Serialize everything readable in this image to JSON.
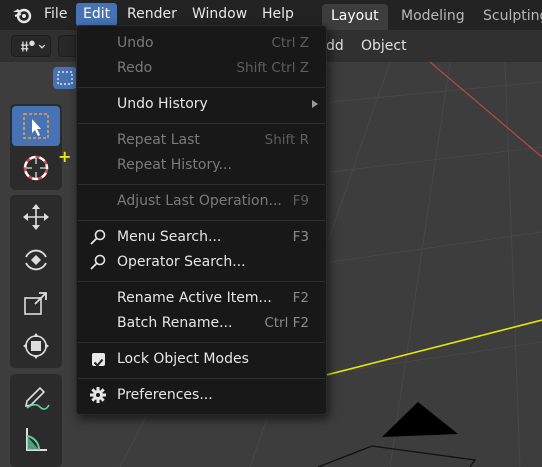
{
  "topbar": {
    "menus": [
      "File",
      "Edit",
      "Render",
      "Window",
      "Help"
    ],
    "active_menu": "Edit",
    "workspaces": [
      "Layout",
      "Modeling",
      "Sculpting"
    ],
    "active_workspace": "Layout"
  },
  "header": {
    "add_label": "dd",
    "object_label": "Object"
  },
  "edit_menu": {
    "items": [
      {
        "label": "Undo",
        "shortcut": "Ctrl Z",
        "enabled": false
      },
      {
        "label": "Redo",
        "shortcut": "Shift Ctrl Z",
        "enabled": false
      },
      {
        "label": "Undo History",
        "shortcut": "",
        "enabled": true,
        "submenu": true
      },
      {
        "label": "Repeat Last",
        "shortcut": "Shift R",
        "enabled": false
      },
      {
        "label": "Repeat History...",
        "shortcut": "",
        "enabled": false
      },
      {
        "label": "Adjust Last Operation...",
        "shortcut": "F9",
        "enabled": false
      },
      {
        "label": "Menu Search...",
        "shortcut": "F3",
        "enabled": true,
        "icon": "search-icon"
      },
      {
        "label": "Operator Search...",
        "shortcut": "",
        "enabled": true,
        "icon": "search-icon"
      },
      {
        "label": "Rename Active Item...",
        "shortcut": "F2",
        "enabled": true
      },
      {
        "label": "Batch Rename...",
        "shortcut": "Ctrl F2",
        "enabled": true
      },
      {
        "label": "Lock Object Modes",
        "shortcut": "",
        "enabled": true,
        "checked": true
      },
      {
        "label": "Preferences...",
        "shortcut": "",
        "enabled": true,
        "icon": "gear-icon"
      }
    ]
  },
  "toolbar": {
    "tools": [
      "select-box-tool",
      "cursor-tool",
      "move-tool",
      "rotate-tool",
      "scale-tool",
      "transform-tool",
      "annotate-tool",
      "measure-tool"
    ],
    "active_tool": "select-box-tool"
  },
  "colors": {
    "accent": "#4772b3",
    "annotation": "#e8e800",
    "axis_x": "#c04a4a"
  }
}
